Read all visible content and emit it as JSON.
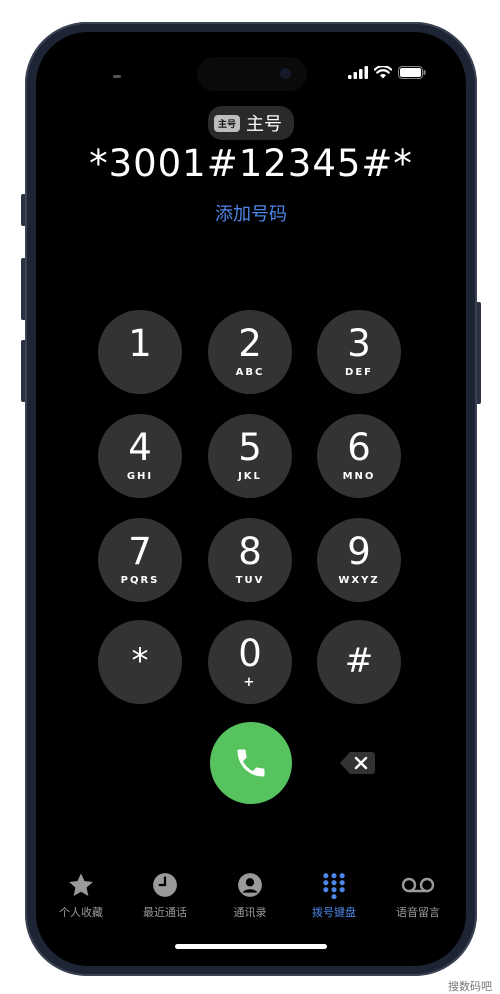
{
  "status_bar": {
    "icons": [
      "signal-icon",
      "wifi-icon",
      "battery-icon"
    ]
  },
  "sim": {
    "tag": "主号",
    "name": "主号"
  },
  "dialed_number": "*3001#12345#*",
  "add_number_label": "添加号码",
  "keypad": [
    {
      "digit": "1",
      "letters": ""
    },
    {
      "digit": "2",
      "letters": "ABC"
    },
    {
      "digit": "3",
      "letters": "DEF"
    },
    {
      "digit": "4",
      "letters": "GHI"
    },
    {
      "digit": "5",
      "letters": "JKL"
    },
    {
      "digit": "6",
      "letters": "MNO"
    },
    {
      "digit": "7",
      "letters": "PQRS"
    },
    {
      "digit": "8",
      "letters": "TUV"
    },
    {
      "digit": "9",
      "letters": "WXYZ"
    },
    {
      "digit": "*",
      "letters": ""
    },
    {
      "digit": "0",
      "letters": "+"
    },
    {
      "digit": "#",
      "letters": ""
    }
  ],
  "tabs": [
    {
      "label": "个人收藏",
      "icon": "star-icon",
      "active": false
    },
    {
      "label": "最近通话",
      "icon": "clock-icon",
      "active": false
    },
    {
      "label": "通讯录",
      "icon": "contact-icon",
      "active": false
    },
    {
      "label": "拨号键盘",
      "icon": "keypad-icon",
      "active": true
    },
    {
      "label": "语音留言",
      "icon": "voicemail-icon",
      "active": false
    }
  ],
  "colors": {
    "accent": "#4d86e8",
    "call": "#56c35f",
    "key": "#333333"
  },
  "watermark": "搜数码吧"
}
